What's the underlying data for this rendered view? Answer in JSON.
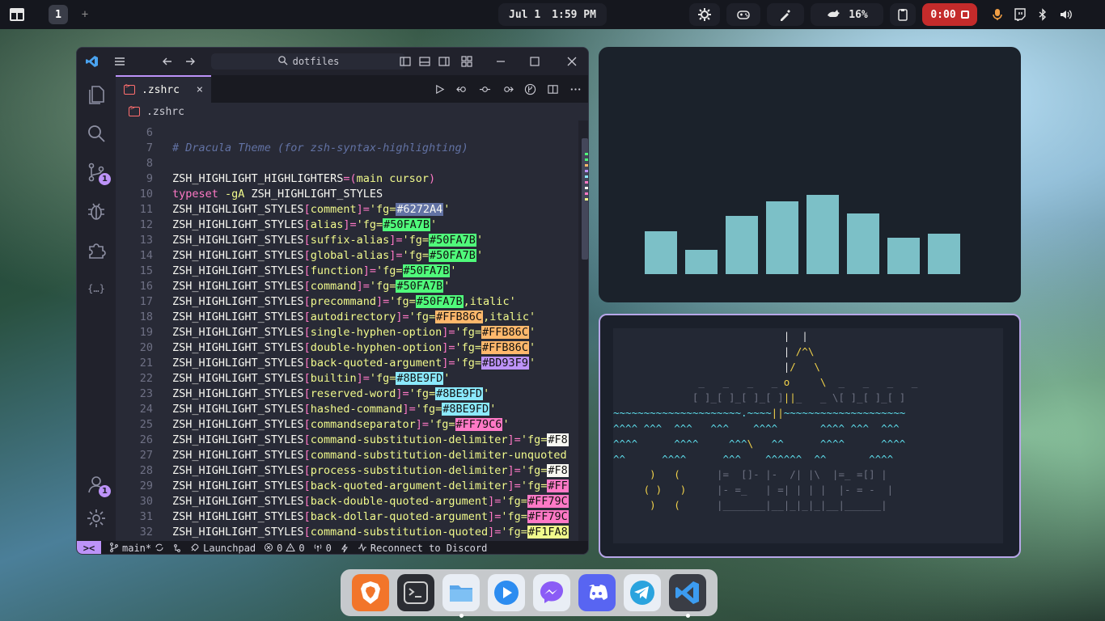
{
  "topbar": {
    "workspace": "1",
    "workspace_add": "+",
    "date": "Jul 1",
    "time": "1:59 PM",
    "battery": "16%",
    "recording": "0:00"
  },
  "vscode": {
    "search": "dotfiles",
    "tab_label": ".zshrc",
    "tab_close": "×",
    "breadcrumb": ".zshrc",
    "scm_badge": "1",
    "account_badge": "1",
    "lines": [
      {
        "n": "6",
        "parts": []
      },
      {
        "n": "7",
        "parts": [
          {
            "t": "# Dracula Theme (for zsh-syntax-highlighting)",
            "c": "c-comment"
          }
        ]
      },
      {
        "n": "8",
        "parts": []
      },
      {
        "n": "9",
        "parts": [
          {
            "t": "ZSH_HIGHLIGHT_HIGHLIGHTERS",
            "c": "c-ident"
          },
          {
            "t": "=(",
            "c": "c-kw"
          },
          {
            "t": "main cursor",
            "c": "c-str"
          },
          {
            "t": ")",
            "c": "c-kw"
          }
        ]
      },
      {
        "n": "10",
        "parts": [
          {
            "t": "typeset",
            "c": "c-kw"
          },
          {
            "t": " -gA ",
            "c": "c-str"
          },
          {
            "t": "ZSH_HIGHLIGHT_STYLES",
            "c": "c-ident"
          }
        ]
      },
      {
        "n": "11",
        "parts": [
          {
            "t": "ZSH_HIGHLIGHT_STYLES",
            "c": "c-ident"
          },
          {
            "t": "[",
            "c": "c-kw"
          },
          {
            "t": "comment",
            "c": "c-str"
          },
          {
            "t": "]=",
            "c": "c-kw"
          },
          {
            "t": "'fg=",
            "c": "c-str"
          },
          {
            "t": "#6272A4",
            "sw": "#6272A4",
            "fgc": "#f8f8f2"
          },
          {
            "t": "'",
            "c": "c-str"
          }
        ]
      },
      {
        "n": "12",
        "parts": [
          {
            "t": "ZSH_HIGHLIGHT_STYLES",
            "c": "c-ident"
          },
          {
            "t": "[",
            "c": "c-kw"
          },
          {
            "t": "alias",
            "c": "c-str"
          },
          {
            "t": "]=",
            "c": "c-kw"
          },
          {
            "t": "'fg=",
            "c": "c-str"
          },
          {
            "t": "#50FA7B",
            "sw": "#50FA7B"
          },
          {
            "t": "'",
            "c": "c-str"
          }
        ]
      },
      {
        "n": "13",
        "parts": [
          {
            "t": "ZSH_HIGHLIGHT_STYLES",
            "c": "c-ident"
          },
          {
            "t": "[",
            "c": "c-kw"
          },
          {
            "t": "suffix-alias",
            "c": "c-str"
          },
          {
            "t": "]=",
            "c": "c-kw"
          },
          {
            "t": "'fg=",
            "c": "c-str"
          },
          {
            "t": "#50FA7B",
            "sw": "#50FA7B"
          },
          {
            "t": "'",
            "c": "c-str"
          }
        ]
      },
      {
        "n": "14",
        "parts": [
          {
            "t": "ZSH_HIGHLIGHT_STYLES",
            "c": "c-ident"
          },
          {
            "t": "[",
            "c": "c-kw"
          },
          {
            "t": "global-alias",
            "c": "c-str"
          },
          {
            "t": "]=",
            "c": "c-kw"
          },
          {
            "t": "'fg=",
            "c": "c-str"
          },
          {
            "t": "#50FA7B",
            "sw": "#50FA7B"
          },
          {
            "t": "'",
            "c": "c-str"
          }
        ]
      },
      {
        "n": "15",
        "parts": [
          {
            "t": "ZSH_HIGHLIGHT_STYLES",
            "c": "c-ident"
          },
          {
            "t": "[",
            "c": "c-kw"
          },
          {
            "t": "function",
            "c": "c-str"
          },
          {
            "t": "]=",
            "c": "c-kw"
          },
          {
            "t": "'fg=",
            "c": "c-str"
          },
          {
            "t": "#50FA7B",
            "sw": "#50FA7B"
          },
          {
            "t": "'",
            "c": "c-str"
          }
        ]
      },
      {
        "n": "16",
        "parts": [
          {
            "t": "ZSH_HIGHLIGHT_STYLES",
            "c": "c-ident"
          },
          {
            "t": "[",
            "c": "c-kw"
          },
          {
            "t": "command",
            "c": "c-str"
          },
          {
            "t": "]=",
            "c": "c-kw"
          },
          {
            "t": "'fg=",
            "c": "c-str"
          },
          {
            "t": "#50FA7B",
            "sw": "#50FA7B"
          },
          {
            "t": "'",
            "c": "c-str"
          }
        ]
      },
      {
        "n": "17",
        "parts": [
          {
            "t": "ZSH_HIGHLIGHT_STYLES",
            "c": "c-ident"
          },
          {
            "t": "[",
            "c": "c-kw"
          },
          {
            "t": "precommand",
            "c": "c-str"
          },
          {
            "t": "]=",
            "c": "c-kw"
          },
          {
            "t": "'fg=",
            "c": "c-str"
          },
          {
            "t": "#50FA7B",
            "sw": "#50FA7B"
          },
          {
            "t": ",italic'",
            "c": "c-str"
          }
        ]
      },
      {
        "n": "18",
        "parts": [
          {
            "t": "ZSH_HIGHLIGHT_STYLES",
            "c": "c-ident"
          },
          {
            "t": "[",
            "c": "c-kw"
          },
          {
            "t": "autodirectory",
            "c": "c-str"
          },
          {
            "t": "]=",
            "c": "c-kw"
          },
          {
            "t": "'fg=",
            "c": "c-str"
          },
          {
            "t": "#FFB86C",
            "sw": "#FFB86C"
          },
          {
            "t": ",italic'",
            "c": "c-str"
          }
        ]
      },
      {
        "n": "19",
        "parts": [
          {
            "t": "ZSH_HIGHLIGHT_STYLES",
            "c": "c-ident"
          },
          {
            "t": "[",
            "c": "c-kw"
          },
          {
            "t": "single-hyphen-option",
            "c": "c-str"
          },
          {
            "t": "]=",
            "c": "c-kw"
          },
          {
            "t": "'fg=",
            "c": "c-str"
          },
          {
            "t": "#FFB86C",
            "sw": "#FFB86C"
          },
          {
            "t": "'",
            "c": "c-str"
          }
        ]
      },
      {
        "n": "20",
        "parts": [
          {
            "t": "ZSH_HIGHLIGHT_STYLES",
            "c": "c-ident"
          },
          {
            "t": "[",
            "c": "c-kw"
          },
          {
            "t": "double-hyphen-option",
            "c": "c-str"
          },
          {
            "t": "]=",
            "c": "c-kw"
          },
          {
            "t": "'fg=",
            "c": "c-str"
          },
          {
            "t": "#FFB86C",
            "sw": "#FFB86C"
          },
          {
            "t": "'",
            "c": "c-str"
          }
        ]
      },
      {
        "n": "21",
        "parts": [
          {
            "t": "ZSH_HIGHLIGHT_STYLES",
            "c": "c-ident"
          },
          {
            "t": "[",
            "c": "c-kw"
          },
          {
            "t": "back-quoted-argument",
            "c": "c-str"
          },
          {
            "t": "]=",
            "c": "c-kw"
          },
          {
            "t": "'fg=",
            "c": "c-str"
          },
          {
            "t": "#BD93F9",
            "sw": "#BD93F9"
          },
          {
            "t": "'",
            "c": "c-str"
          }
        ]
      },
      {
        "n": "22",
        "parts": [
          {
            "t": "ZSH_HIGHLIGHT_STYLES",
            "c": "c-ident"
          },
          {
            "t": "[",
            "c": "c-kw"
          },
          {
            "t": "builtin",
            "c": "c-str"
          },
          {
            "t": "]=",
            "c": "c-kw"
          },
          {
            "t": "'fg=",
            "c": "c-str"
          },
          {
            "t": "#8BE9FD",
            "sw": "#8BE9FD"
          },
          {
            "t": "'",
            "c": "c-str"
          }
        ]
      },
      {
        "n": "23",
        "parts": [
          {
            "t": "ZSH_HIGHLIGHT_STYLES",
            "c": "c-ident"
          },
          {
            "t": "[",
            "c": "c-kw"
          },
          {
            "t": "reserved-word",
            "c": "c-str"
          },
          {
            "t": "]=",
            "c": "c-kw"
          },
          {
            "t": "'fg=",
            "c": "c-str"
          },
          {
            "t": "#8BE9FD",
            "sw": "#8BE9FD"
          },
          {
            "t": "'",
            "c": "c-str"
          }
        ]
      },
      {
        "n": "24",
        "parts": [
          {
            "t": "ZSH_HIGHLIGHT_STYLES",
            "c": "c-ident"
          },
          {
            "t": "[",
            "c": "c-kw"
          },
          {
            "t": "hashed-command",
            "c": "c-str"
          },
          {
            "t": "]=",
            "c": "c-kw"
          },
          {
            "t": "'fg=",
            "c": "c-str"
          },
          {
            "t": "#8BE9FD",
            "sw": "#8BE9FD"
          },
          {
            "t": "'",
            "c": "c-str"
          }
        ]
      },
      {
        "n": "25",
        "parts": [
          {
            "t": "ZSH_HIGHLIGHT_STYLES",
            "c": "c-ident"
          },
          {
            "t": "[",
            "c": "c-kw"
          },
          {
            "t": "commandseparator",
            "c": "c-str"
          },
          {
            "t": "]=",
            "c": "c-kw"
          },
          {
            "t": "'fg=",
            "c": "c-str"
          },
          {
            "t": "#FF79C6",
            "sw": "#FF79C6"
          },
          {
            "t": "'",
            "c": "c-str"
          }
        ]
      },
      {
        "n": "26",
        "parts": [
          {
            "t": "ZSH_HIGHLIGHT_STYLES",
            "c": "c-ident"
          },
          {
            "t": "[",
            "c": "c-kw"
          },
          {
            "t": "command-substitution-delimiter",
            "c": "c-str"
          },
          {
            "t": "]=",
            "c": "c-kw"
          },
          {
            "t": "'fg=",
            "c": "c-str"
          },
          {
            "t": "#F8",
            "sw": "#F8F8F2"
          }
        ]
      },
      {
        "n": "27",
        "parts": [
          {
            "t": "ZSH_HIGHLIGHT_STYLES",
            "c": "c-ident"
          },
          {
            "t": "[",
            "c": "c-kw"
          },
          {
            "t": "command-substitution-delimiter-unquoted",
            "c": "c-str"
          }
        ]
      },
      {
        "n": "28",
        "parts": [
          {
            "t": "ZSH_HIGHLIGHT_STYLES",
            "c": "c-ident"
          },
          {
            "t": "[",
            "c": "c-kw"
          },
          {
            "t": "process-substitution-delimiter",
            "c": "c-str"
          },
          {
            "t": "]=",
            "c": "c-kw"
          },
          {
            "t": "'fg=",
            "c": "c-str"
          },
          {
            "t": "#F8",
            "sw": "#F8F8F2"
          }
        ]
      },
      {
        "n": "29",
        "parts": [
          {
            "t": "ZSH_HIGHLIGHT_STYLES",
            "c": "c-ident"
          },
          {
            "t": "[",
            "c": "c-kw"
          },
          {
            "t": "back-quoted-argument-delimiter",
            "c": "c-str"
          },
          {
            "t": "]=",
            "c": "c-kw"
          },
          {
            "t": "'fg=",
            "c": "c-str"
          },
          {
            "t": "#FF",
            "sw": "#FF79C6"
          }
        ]
      },
      {
        "n": "30",
        "parts": [
          {
            "t": "ZSH_HIGHLIGHT_STYLES",
            "c": "c-ident"
          },
          {
            "t": "[",
            "c": "c-kw"
          },
          {
            "t": "back-double-quoted-argument",
            "c": "c-str"
          },
          {
            "t": "]=",
            "c": "c-kw"
          },
          {
            "t": "'fg=",
            "c": "c-str"
          },
          {
            "t": "#FF79C",
            "sw": "#FF79C6"
          }
        ]
      },
      {
        "n": "31",
        "parts": [
          {
            "t": "ZSH_HIGHLIGHT_STYLES",
            "c": "c-ident"
          },
          {
            "t": "[",
            "c": "c-kw"
          },
          {
            "t": "back-dollar-quoted-argument",
            "c": "c-str"
          },
          {
            "t": "]=",
            "c": "c-kw"
          },
          {
            "t": "'fg=",
            "c": "c-str"
          },
          {
            "t": "#FF79C",
            "sw": "#FF79C6"
          }
        ]
      },
      {
        "n": "32",
        "parts": [
          {
            "t": "ZSH_HIGHLIGHT_STYLES",
            "c": "c-ident"
          },
          {
            "t": "[",
            "c": "c-kw"
          },
          {
            "t": "command-substitution-quoted",
            "c": "c-str"
          },
          {
            "t": "]=",
            "c": "c-kw"
          },
          {
            "t": "'fg=",
            "c": "c-str"
          },
          {
            "t": "#F1FA8",
            "sw": "#F1FA8C"
          }
        ]
      }
    ],
    "status": {
      "remote": "><",
      "branch": "main*",
      "launchpad": "Launchpad",
      "errors": "0",
      "warnings": "0",
      "ports": "0",
      "discord": "Reconnect to Discord"
    }
  },
  "visualizer": {
    "bar_levels": [
      0.33,
      0.19,
      0.45,
      0.56,
      0.61,
      0.47,
      0.28,
      0.31
    ],
    "color": "#8ad6dd"
  },
  "terminal_art": [
    [
      {
        "t": "                            |  |",
        "c": "w1"
      }
    ],
    [
      {
        "t": "                            | ",
        "c": "w1"
      },
      {
        "t": "/^\\",
        "c": "y"
      }
    ],
    [
      {
        "t": "                            |",
        "c": "w1"
      },
      {
        "t": "/   \\",
        "c": "y"
      }
    ],
    [
      {
        "t": "              _   _   _   _ ",
        "c": "dim"
      },
      {
        "t": "o",
        "c": "y"
      },
      {
        "t": "     \\  ",
        "c": "y"
      },
      {
        "t": "_   _   _   _",
        "c": "dim"
      }
    ],
    [
      {
        "t": "             [ ]_[ ]_[ ]_[ ]",
        "c": "dim"
      },
      {
        "t": "||",
        "c": "y"
      },
      {
        "t": "_   _ \\[ ]_[ ]_[ ]",
        "c": "dim"
      }
    ],
    [
      {
        "t": "~~~~~~~~~~~~~~~~~~~~~.~~~~",
        "c": "cy"
      },
      {
        "t": "||",
        "c": "y"
      },
      {
        "t": "~~~~~~~~~~~~~~~~~~~~",
        "c": "cy"
      }
    ],
    [
      {
        "t": "^^^^ ^^^  ^^^   ^^^    ^^^^       ^^^^ ^^^  ^^^",
        "c": "cy"
      }
    ],
    [
      {
        "t": "^^^^      ^^^^     ^^^",
        "c": "cy"
      },
      {
        "t": "\\",
        "c": "y"
      },
      {
        "t": "   ^^      ^^^^      ^^^^",
        "c": "cy"
      }
    ],
    [
      {
        "t": "^^      ^^^^      ^^^    ^^^^^^  ^^       ^^^^",
        "c": "cy"
      }
    ],
    [
      {
        "t": "      )   (     ",
        "c": "y"
      },
      {
        "t": " |=  []- |-  /| |\\  |=_ =[] |",
        "c": "dim"
      }
    ],
    [
      {
        "t": "     ( )   )    ",
        "c": "y"
      },
      {
        "t": " |- =_   | =| | | |  |- = -  |",
        "c": "dim"
      }
    ],
    [
      {
        "t": "      )   (     ",
        "c": "y"
      },
      {
        "t": " |_______|__|_|_|_|__|______|",
        "c": "dim"
      }
    ]
  ],
  "dock": [
    "brave",
    "terminal",
    "files",
    "media-player",
    "messenger",
    "discord",
    "telegram",
    "vscode"
  ]
}
